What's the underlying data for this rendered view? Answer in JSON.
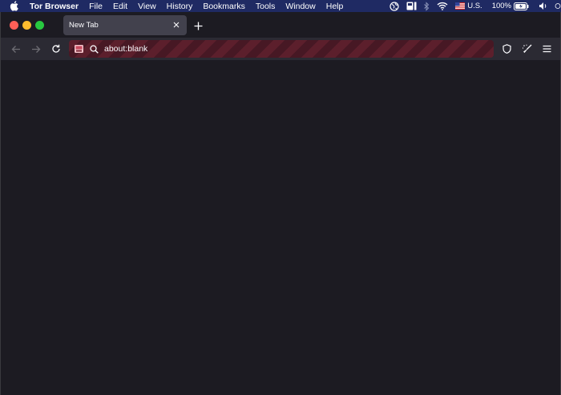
{
  "menubar": {
    "app_name": "Tor Browser",
    "items": [
      "File",
      "Edit",
      "View",
      "History",
      "Bookmarks",
      "Tools",
      "Window",
      "Help"
    ],
    "input_source": "U.S.",
    "battery_percent": "100%"
  },
  "tabs": [
    {
      "title": "New Tab"
    }
  ],
  "urlbar": {
    "value": "about:blank"
  },
  "colors": {
    "menubar_bg": "#1f2a63",
    "window_bg": "#1c1b22",
    "tab_active_bg": "#42414d",
    "navbar_bg": "#2b2a33",
    "urlbar_stripe_a": "#5c1f2c",
    "urlbar_stripe_b": "#471824"
  }
}
